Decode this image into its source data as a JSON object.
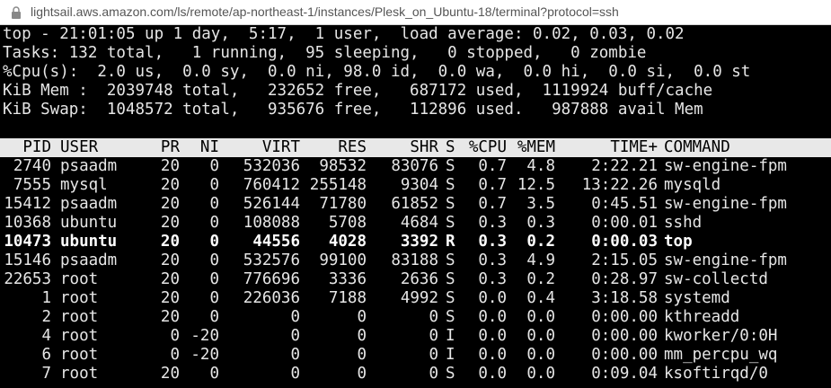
{
  "browser": {
    "url": "lightsail.aws.amazon.com/ls/remote/ap-northeast-1/instances/Plesk_on_Ubuntu-18/terminal?protocol=ssh"
  },
  "top": {
    "summary": [
      "top - 21:01:05 up 1 day,  5:17,  1 user,  load average: 0.02, 0.03, 0.02",
      "Tasks: 132 total,   1 running,  95 sleeping,   0 stopped,   0 zombie",
      "%Cpu(s):  2.0 us,  0.0 sy,  0.0 ni, 98.0 id,  0.0 wa,  0.0 hi,  0.0 si,  0.0 st",
      "KiB Mem :  2039748 total,   232652 free,   687172 used,  1119924 buff/cache",
      "KiB Swap:  1048572 total,   935676 free,   112896 used.   987888 avail Mem"
    ],
    "columns": [
      "PID",
      "USER",
      "PR",
      "NI",
      "VIRT",
      "RES",
      "SHR",
      "S",
      "%CPU",
      "%MEM",
      "TIME+",
      "COMMAND"
    ],
    "processes": [
      {
        "pid": "2740",
        "user": "psaadm",
        "pr": "20",
        "ni": "0",
        "virt": "532036",
        "res": "98532",
        "shr": "83076",
        "s": "S",
        "cpu": "0.7",
        "mem": "4.8",
        "time": "2:22.21",
        "command": "sw-engine-fpm"
      },
      {
        "pid": "7555",
        "user": "mysql",
        "pr": "20",
        "ni": "0",
        "virt": "760412",
        "res": "255148",
        "shr": "9304",
        "s": "S",
        "cpu": "0.7",
        "mem": "12.5",
        "time": "13:22.26",
        "command": "mysqld"
      },
      {
        "pid": "15412",
        "user": "psaadm",
        "pr": "20",
        "ni": "0",
        "virt": "526144",
        "res": "71780",
        "shr": "61852",
        "s": "S",
        "cpu": "0.7",
        "mem": "3.5",
        "time": "0:45.51",
        "command": "sw-engine-fpm"
      },
      {
        "pid": "10368",
        "user": "ubuntu",
        "pr": "20",
        "ni": "0",
        "virt": "108088",
        "res": "5708",
        "shr": "4684",
        "s": "S",
        "cpu": "0.3",
        "mem": "0.3",
        "time": "0:00.01",
        "command": "sshd"
      },
      {
        "pid": "10473",
        "user": "ubuntu",
        "pr": "20",
        "ni": "0",
        "virt": "44556",
        "res": "4028",
        "shr": "3392",
        "s": "R",
        "cpu": "0.3",
        "mem": "0.2",
        "time": "0:00.03",
        "command": "top"
      },
      {
        "pid": "15146",
        "user": "psaadm",
        "pr": "20",
        "ni": "0",
        "virt": "532576",
        "res": "99100",
        "shr": "83188",
        "s": "S",
        "cpu": "0.3",
        "mem": "4.9",
        "time": "2:15.05",
        "command": "sw-engine-fpm"
      },
      {
        "pid": "22653",
        "user": "root",
        "pr": "20",
        "ni": "0",
        "virt": "776696",
        "res": "3336",
        "shr": "2636",
        "s": "S",
        "cpu": "0.3",
        "mem": "0.2",
        "time": "0:28.97",
        "command": "sw-collectd"
      },
      {
        "pid": "1",
        "user": "root",
        "pr": "20",
        "ni": "0",
        "virt": "226036",
        "res": "7188",
        "shr": "4992",
        "s": "S",
        "cpu": "0.0",
        "mem": "0.4",
        "time": "3:18.58",
        "command": "systemd"
      },
      {
        "pid": "2",
        "user": "root",
        "pr": "20",
        "ni": "0",
        "virt": "0",
        "res": "0",
        "shr": "0",
        "s": "S",
        "cpu": "0.0",
        "mem": "0.0",
        "time": "0:00.00",
        "command": "kthreadd"
      },
      {
        "pid": "4",
        "user": "root",
        "pr": "0",
        "ni": "-20",
        "virt": "0",
        "res": "0",
        "shr": "0",
        "s": "I",
        "cpu": "0.0",
        "mem": "0.0",
        "time": "0:00.00",
        "command": "kworker/0:0H"
      },
      {
        "pid": "6",
        "user": "root",
        "pr": "0",
        "ni": "-20",
        "virt": "0",
        "res": "0",
        "shr": "0",
        "s": "I",
        "cpu": "0.0",
        "mem": "0.0",
        "time": "0:00.00",
        "command": "mm_percpu_wq"
      },
      {
        "pid": "7",
        "user": "root",
        "pr": "20",
        "ni": "0",
        "virt": "0",
        "res": "0",
        "shr": "0",
        "s": "S",
        "cpu": "0.0",
        "mem": "0.0",
        "time": "0:09.04",
        "command": "ksoftirqd/0"
      }
    ],
    "highlighted_pid": "10473"
  },
  "colors": {
    "terminal_bg": "#000000",
    "terminal_fg": "#e6e6e6",
    "header_bg": "#e8e8e8"
  }
}
